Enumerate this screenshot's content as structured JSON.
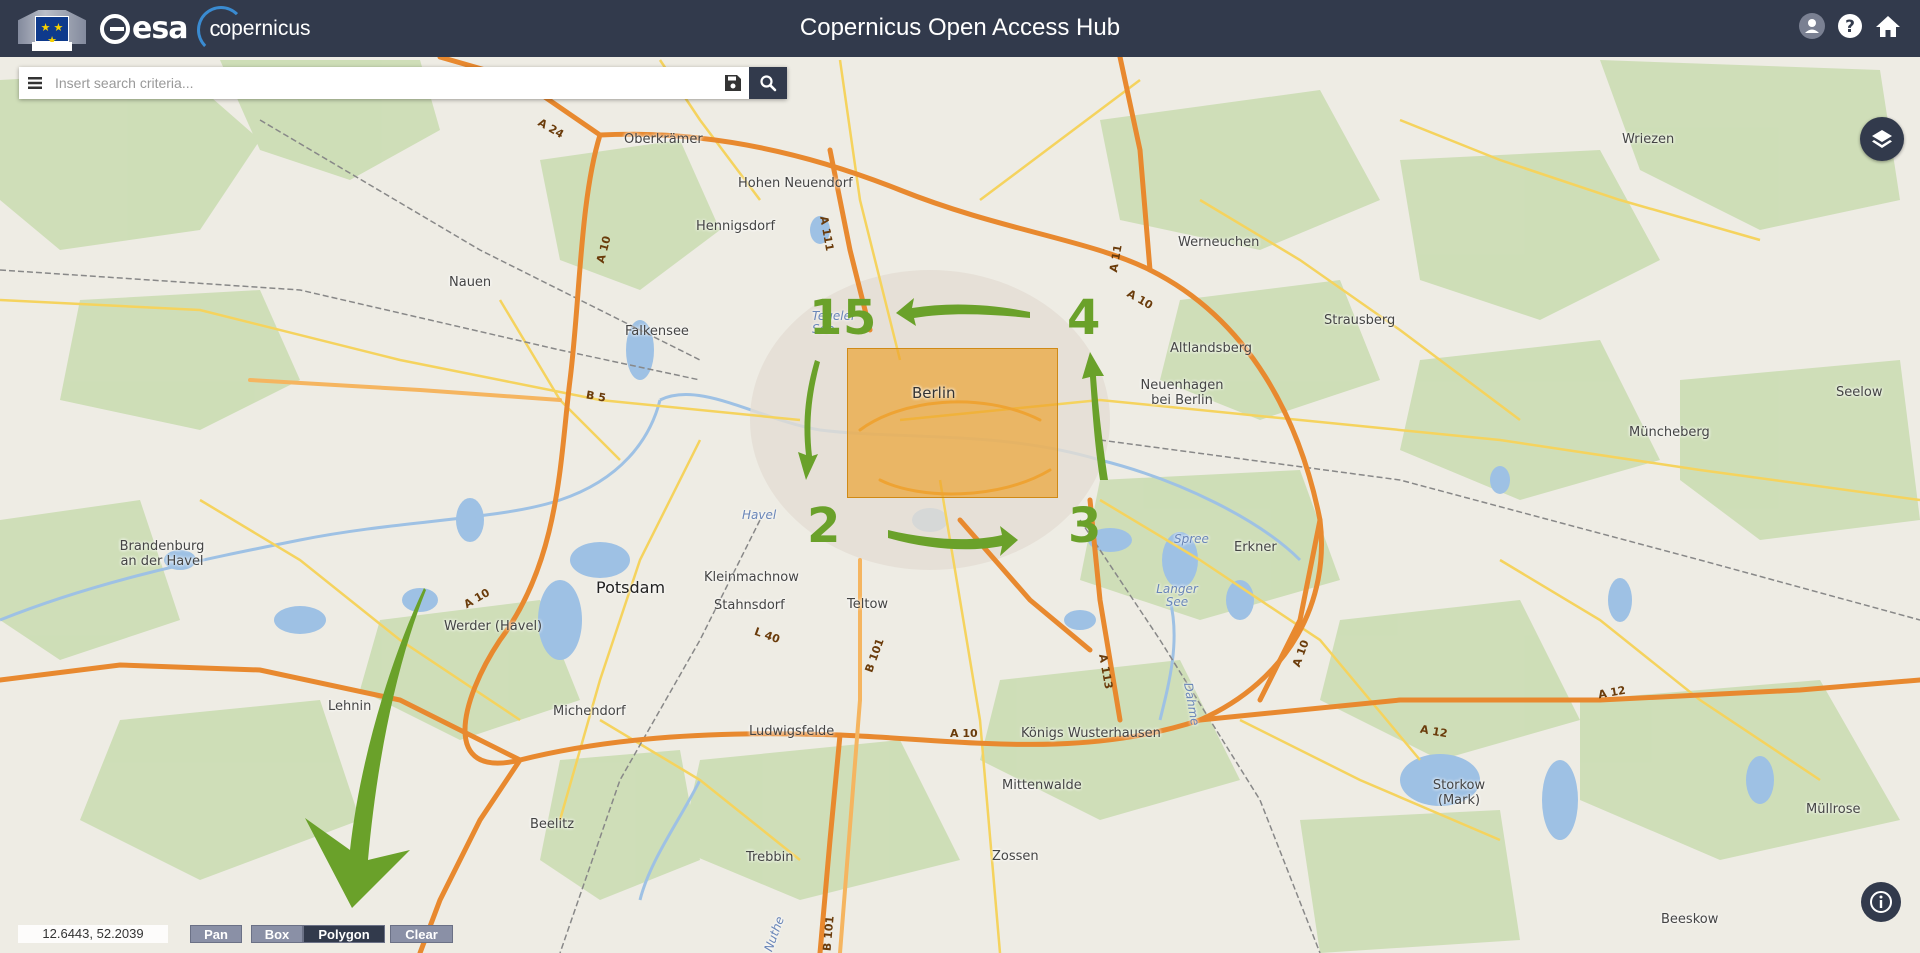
{
  "header": {
    "title": "Copernicus Open Access Hub",
    "esa_text": "esa",
    "copernicus_text": "opernicus",
    "icons": [
      "user-icon",
      "help-icon",
      "home-icon"
    ]
  },
  "search": {
    "placeholder": "Insert search criteria...",
    "value": "",
    "icons": [
      "menu-icon",
      "save-icon",
      "search-icon"
    ]
  },
  "map": {
    "places": [
      {
        "name": "Oberkrämer",
        "type": "town"
      },
      {
        "name": "Hohen Neuendorf",
        "type": "town"
      },
      {
        "name": "Hennigsdorf",
        "type": "town"
      },
      {
        "name": "Nauen",
        "type": "town"
      },
      {
        "name": "Falkensee",
        "type": "town"
      },
      {
        "name": "Tegeler See",
        "type": "water"
      },
      {
        "name": "Berlin",
        "type": "city"
      },
      {
        "name": "Havel",
        "type": "water"
      },
      {
        "name": "Brandenburg an der Havel",
        "type": "town"
      },
      {
        "name": "Potsdam",
        "type": "city"
      },
      {
        "name": "Kleinmachnow",
        "type": "town"
      },
      {
        "name": "Stahnsdorf",
        "type": "town"
      },
      {
        "name": "Teltow",
        "type": "town"
      },
      {
        "name": "Werder (Havel)",
        "type": "town"
      },
      {
        "name": "Lehnin",
        "type": "town"
      },
      {
        "name": "Michendorf",
        "type": "town"
      },
      {
        "name": "Ludwigsfelde",
        "type": "town"
      },
      {
        "name": "Beelitz",
        "type": "town"
      },
      {
        "name": "Trebbin",
        "type": "town"
      },
      {
        "name": "Zossen",
        "type": "town"
      },
      {
        "name": "Mittenwalde",
        "type": "town"
      },
      {
        "name": "Königs Wusterhausen",
        "type": "town"
      },
      {
        "name": "Werneuchen",
        "type": "town"
      },
      {
        "name": "Altlandsberg",
        "type": "town"
      },
      {
        "name": "Neuenhagen bei Berlin",
        "type": "town"
      },
      {
        "name": "Strausberg",
        "type": "town"
      },
      {
        "name": "Erkner",
        "type": "town"
      },
      {
        "name": "Spree",
        "type": "water"
      },
      {
        "name": "Langer See",
        "type": "water"
      },
      {
        "name": "Wriezen",
        "type": "town"
      },
      {
        "name": "Seelow",
        "type": "town"
      },
      {
        "name": "Müncheberg",
        "type": "town"
      },
      {
        "name": "Storkow (Mark)",
        "type": "town"
      },
      {
        "name": "Müllrose",
        "type": "town"
      },
      {
        "name": "Beeskow",
        "type": "town"
      },
      {
        "name": "Dahme",
        "type": "water"
      },
      {
        "name": "Nuthe",
        "type": "water"
      }
    ],
    "road_labels": [
      "A 24",
      "A 10",
      "A 111",
      "A 11",
      "A 10",
      "B 5",
      "A 10",
      "L 40",
      "B 101",
      "A 10",
      "A 113",
      "A 10",
      "A 12",
      "A 12",
      "B 101"
    ],
    "annotations": [
      "1",
      "5",
      "4",
      "2",
      "3"
    ]
  },
  "controls": {
    "layers_icon": "layers-icon",
    "info_icon": "info-icon"
  },
  "footer": {
    "coordinates": "12.6443, 52.2039",
    "tools": {
      "pan": "Pan",
      "box": "Box",
      "polygon": "Polygon",
      "clear": "Clear"
    },
    "active_tool": "polygon"
  }
}
